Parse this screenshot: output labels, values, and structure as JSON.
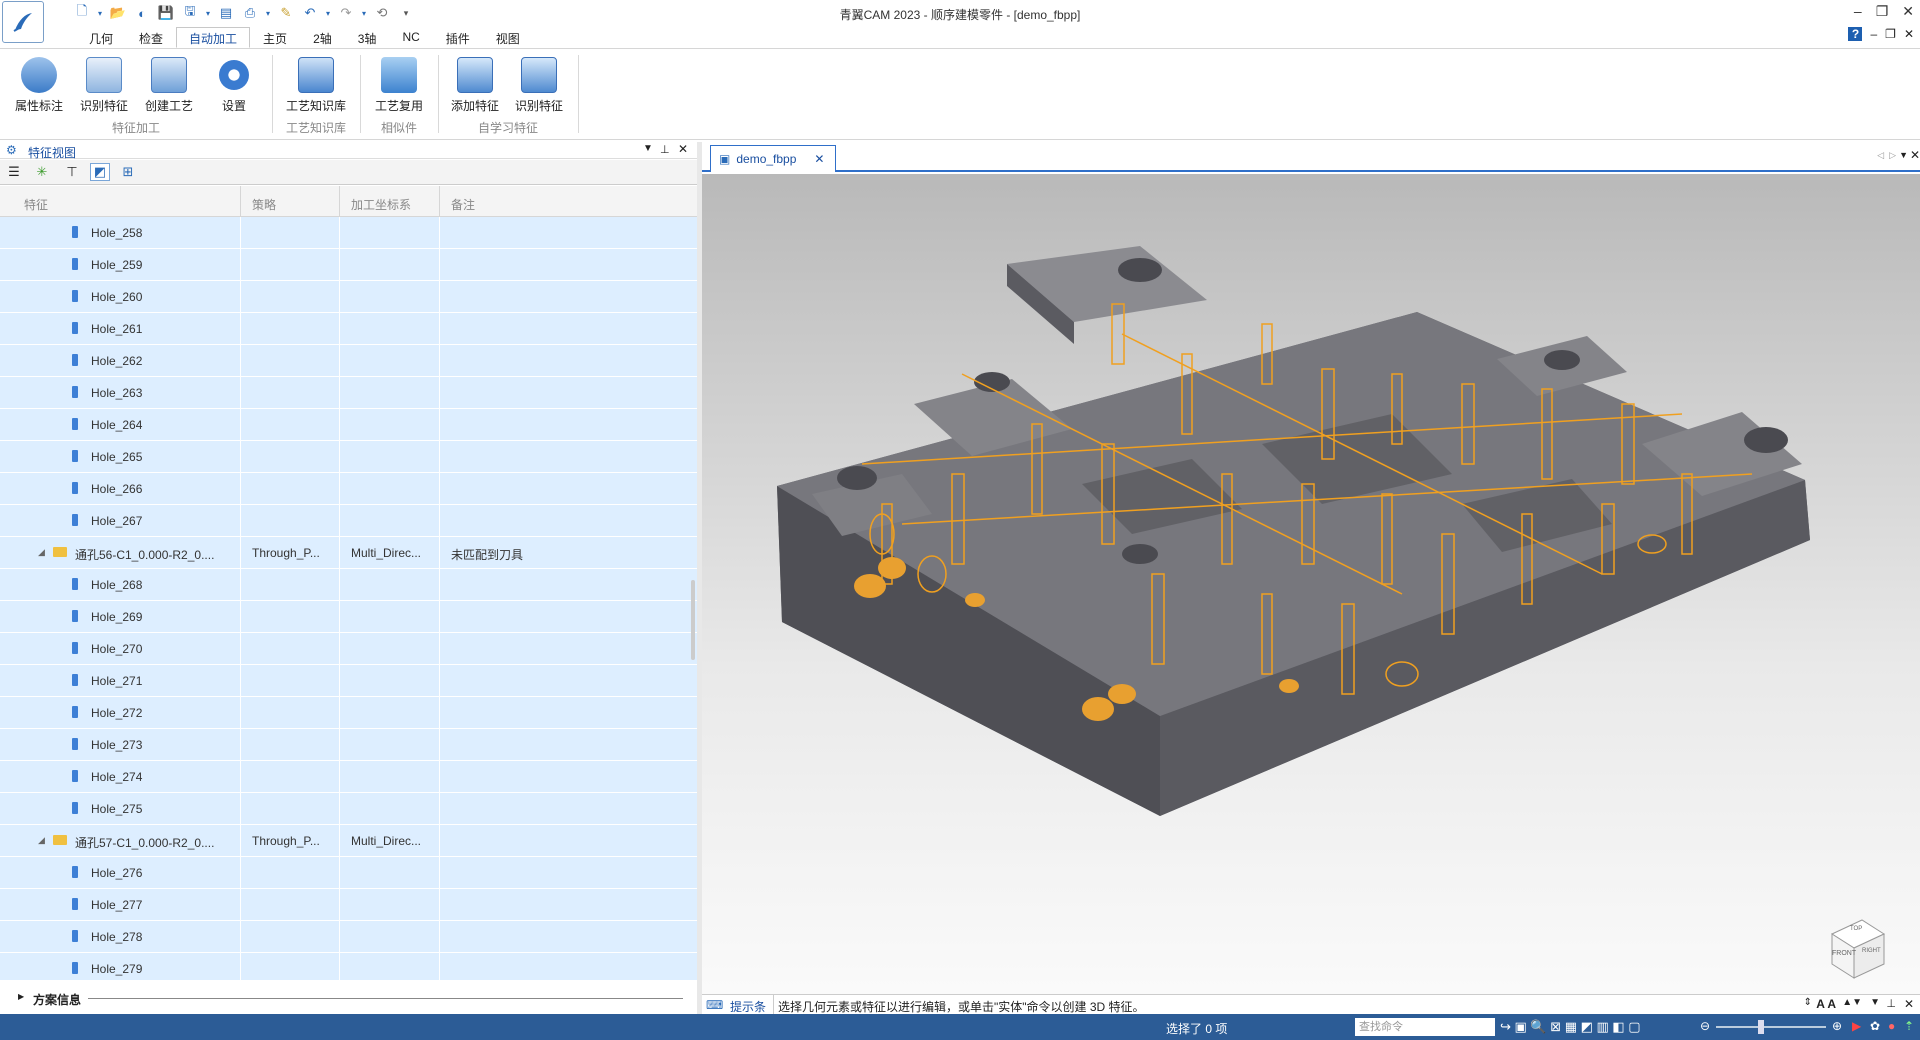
{
  "app": {
    "title": "青翼CAM 2023 - 顺序建模零件 - [demo_fbpp]"
  },
  "ribbon_tabs": [
    "几何",
    "检查",
    "自动加工",
    "主页",
    "2轴",
    "3轴",
    "NC",
    "插件",
    "视图"
  ],
  "ribbon": {
    "buttons": [
      "属性标注",
      "识别特征",
      "创建工艺",
      "设置",
      "工艺知识库",
      "工艺复用",
      "添加特征",
      "识别特征"
    ],
    "groups": [
      "特征加工",
      "工艺知识库",
      "相似件",
      "自学习特征"
    ]
  },
  "panel": {
    "title": "特征视图",
    "columns": [
      "特征",
      "策略",
      "加工坐标系",
      "备注"
    ],
    "scheme_info": "方案信息"
  },
  "rows": [
    {
      "type": "hole",
      "name": "Hole_258"
    },
    {
      "type": "hole",
      "name": "Hole_259"
    },
    {
      "type": "hole",
      "name": "Hole_260"
    },
    {
      "type": "hole",
      "name": "Hole_261"
    },
    {
      "type": "hole",
      "name": "Hole_262"
    },
    {
      "type": "hole",
      "name": "Hole_263"
    },
    {
      "type": "hole",
      "name": "Hole_264"
    },
    {
      "type": "hole",
      "name": "Hole_265"
    },
    {
      "type": "hole",
      "name": "Hole_266"
    },
    {
      "type": "hole",
      "name": "Hole_267"
    },
    {
      "type": "group",
      "name": "通孔56-C1_0.000-R2_0....",
      "strategy": "Through_P...",
      "coord": "Multi_Direc...",
      "note": "未匹配到刀具"
    },
    {
      "type": "hole",
      "name": "Hole_268"
    },
    {
      "type": "hole",
      "name": "Hole_269"
    },
    {
      "type": "hole",
      "name": "Hole_270"
    },
    {
      "type": "hole",
      "name": "Hole_271"
    },
    {
      "type": "hole",
      "name": "Hole_272"
    },
    {
      "type": "hole",
      "name": "Hole_273"
    },
    {
      "type": "hole",
      "name": "Hole_274"
    },
    {
      "type": "hole",
      "name": "Hole_275"
    },
    {
      "type": "group",
      "name": "通孔57-C1_0.000-R2_0....",
      "strategy": "Through_P...",
      "coord": "Multi_Direc...",
      "note": ""
    },
    {
      "type": "hole",
      "name": "Hole_276"
    },
    {
      "type": "hole",
      "name": "Hole_277"
    },
    {
      "type": "hole",
      "name": "Hole_278"
    },
    {
      "type": "hole",
      "name": "Hole_279"
    }
  ],
  "doc": {
    "tab": "demo_fbpp"
  },
  "hint": {
    "label": "提示条",
    "text": "选择几何元素或特征以进行编辑，或单击\"实体\"命令以创建 3D 特征。"
  },
  "status": {
    "selected": "选择了 0 项",
    "search_placeholder": "查找命令"
  },
  "viewcube": {
    "face_front": "FRONT",
    "face_right": "RIGHT",
    "face_top": "TOP"
  },
  "colors": {
    "accent": "#2f6fc9",
    "selection": "#ddeeff",
    "status": "#2c5c96",
    "part": "#5f5f64",
    "hole": "#f0a020"
  }
}
